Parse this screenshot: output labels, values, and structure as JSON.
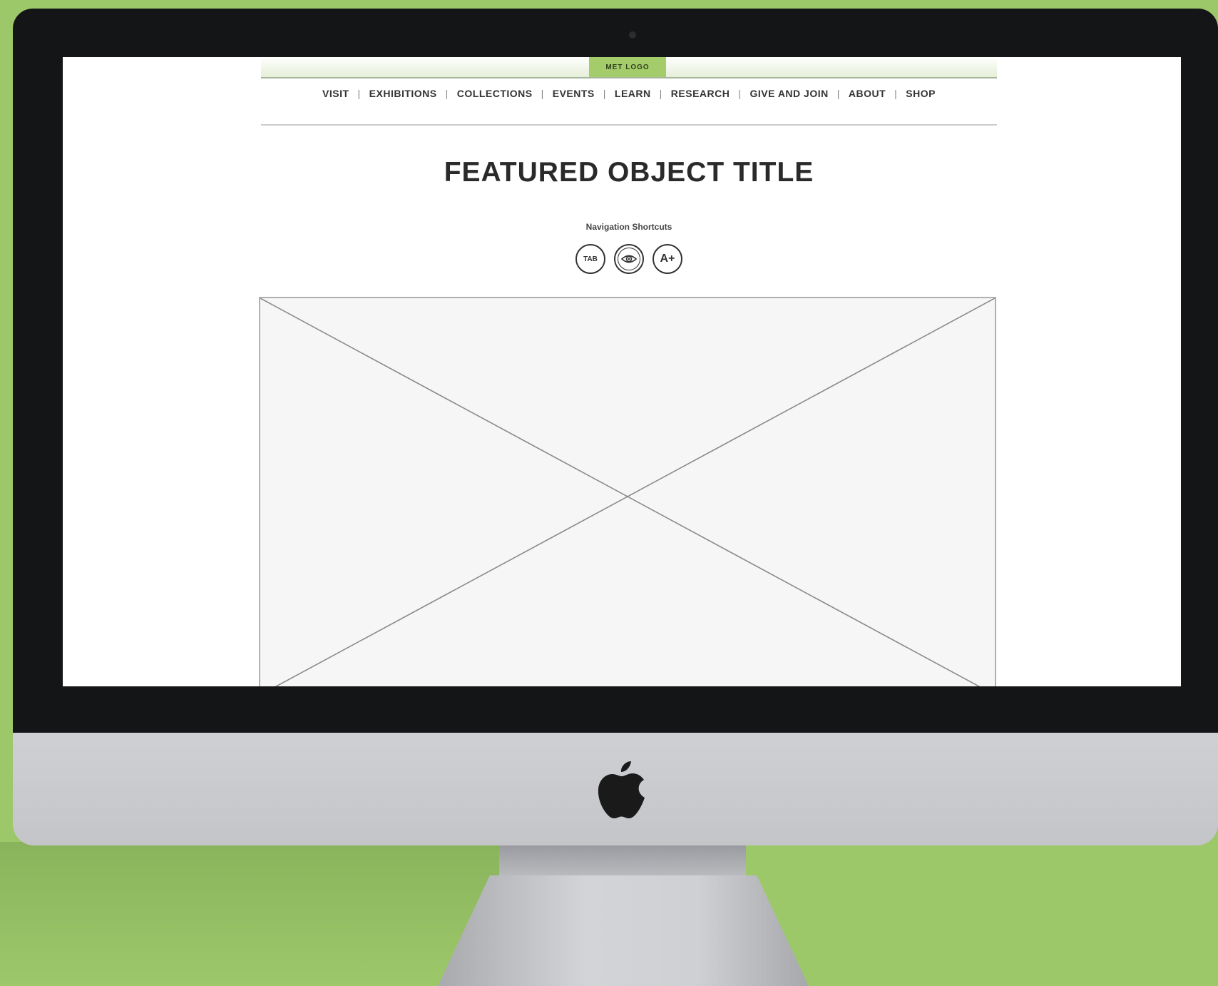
{
  "header": {
    "logo_label": "MET LOGO"
  },
  "nav": {
    "items": [
      {
        "label": "VISIT"
      },
      {
        "label": "EXHIBITIONS"
      },
      {
        "label": "COLLECTIONS"
      },
      {
        "label": "EVENTS"
      },
      {
        "label": "LEARN"
      },
      {
        "label": "RESEARCH"
      },
      {
        "label": "GIVE AND JOIN"
      },
      {
        "label": "ABOUT"
      },
      {
        "label": "SHOP"
      }
    ],
    "separator": "|"
  },
  "main": {
    "title": "FEATURED OBJECT TITLE",
    "shortcuts_label": "Navigation Shortcuts",
    "shortcuts": [
      {
        "label": "TAB",
        "icon": "tab-key-icon"
      },
      {
        "label": "",
        "icon": "eye-icon"
      },
      {
        "label": "A+",
        "icon": "text-size-icon"
      }
    ],
    "image_placeholder_icon": "image-placeholder-icon"
  },
  "colors": {
    "background": "#9dc86a",
    "logo_accent": "#a5cc6b",
    "bezel": "#141516",
    "chin": "#c8c9cc"
  },
  "device": {
    "logo_icon": "apple-logo-icon"
  }
}
